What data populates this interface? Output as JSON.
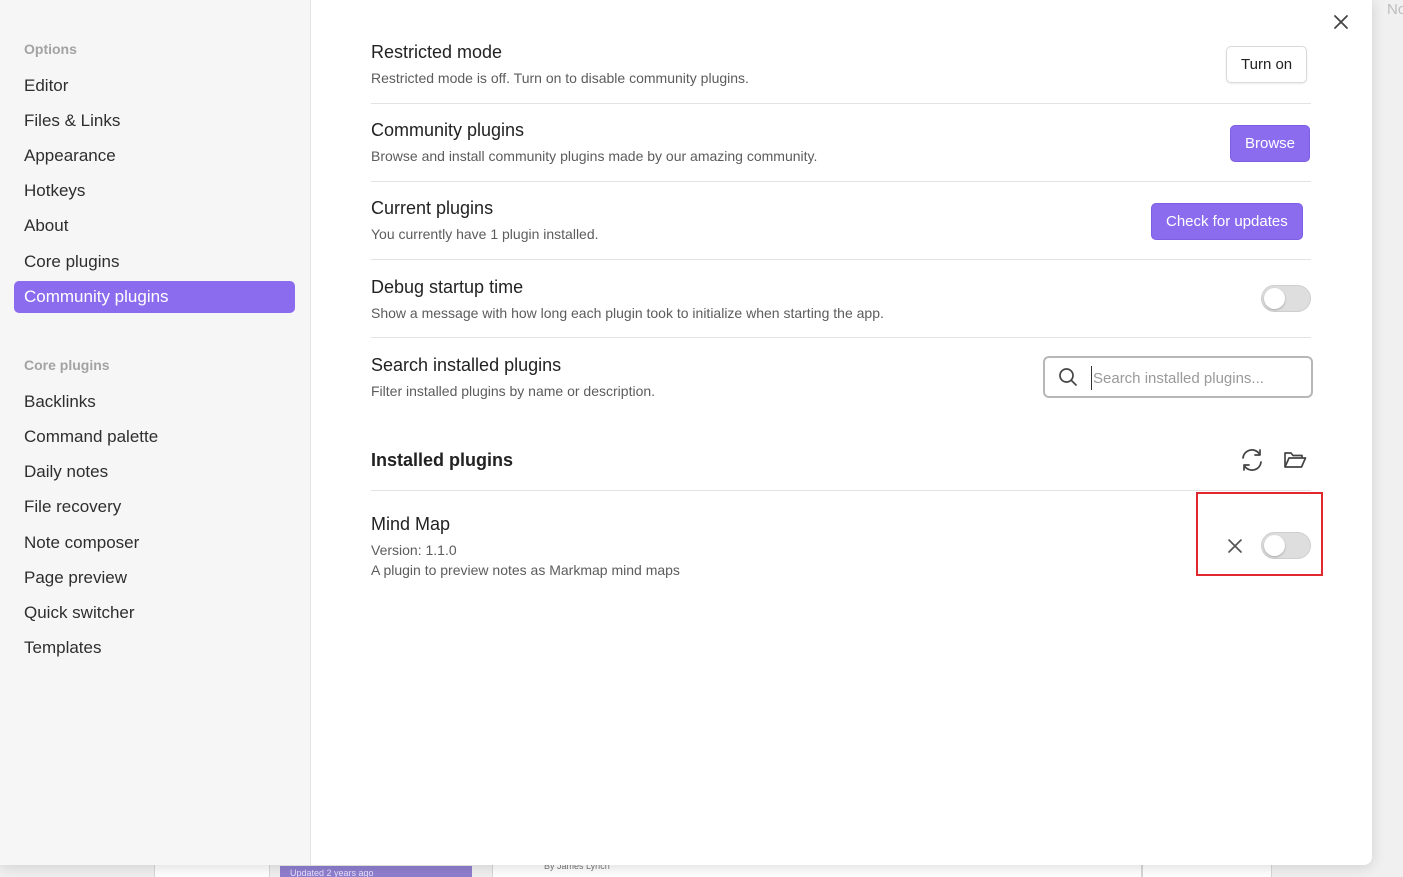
{
  "sidebar": {
    "options_heading": "Options",
    "options_items": [
      {
        "label": "Editor"
      },
      {
        "label": "Files & Links"
      },
      {
        "label": "Appearance"
      },
      {
        "label": "Hotkeys"
      },
      {
        "label": "About"
      },
      {
        "label": "Core plugins"
      },
      {
        "label": "Community plugins",
        "active": true
      }
    ],
    "core_heading": "Core plugins",
    "core_items": [
      {
        "label": "Backlinks"
      },
      {
        "label": "Command palette"
      },
      {
        "label": "Daily notes"
      },
      {
        "label": "File recovery"
      },
      {
        "label": "Note composer"
      },
      {
        "label": "Page preview"
      },
      {
        "label": "Quick switcher"
      },
      {
        "label": "Templates"
      }
    ]
  },
  "settings": {
    "restricted": {
      "title": "Restricted mode",
      "desc": "Restricted mode is off. Turn on to disable community plugins.",
      "button": "Turn on"
    },
    "community": {
      "title": "Community plugins",
      "desc": "Browse and install community plugins made by our amazing community.",
      "button": "Browse"
    },
    "current": {
      "title": "Current plugins",
      "desc": "You currently have 1 plugin installed.",
      "button": "Check for updates"
    },
    "debug": {
      "title": "Debug startup time",
      "desc": "Show a message with how long each plugin took to initialize when starting the app.",
      "enabled": false
    },
    "search": {
      "title": "Search installed plugins",
      "desc": "Filter installed plugins by name or description.",
      "placeholder": "Search installed plugins..."
    }
  },
  "installed": {
    "heading": "Installed plugins",
    "plugins": [
      {
        "name": "Mind Map",
        "version": "Version: 1.1.0",
        "desc": "A plugin to preview notes as Markmap mind maps",
        "enabled": false
      }
    ]
  },
  "background": {
    "corner_text": "No",
    "card_badge": "Updated 2 years ago",
    "card_author": "By James Lynch"
  },
  "colors": {
    "accent": "#8b6cef",
    "highlight": "#e0282e"
  }
}
